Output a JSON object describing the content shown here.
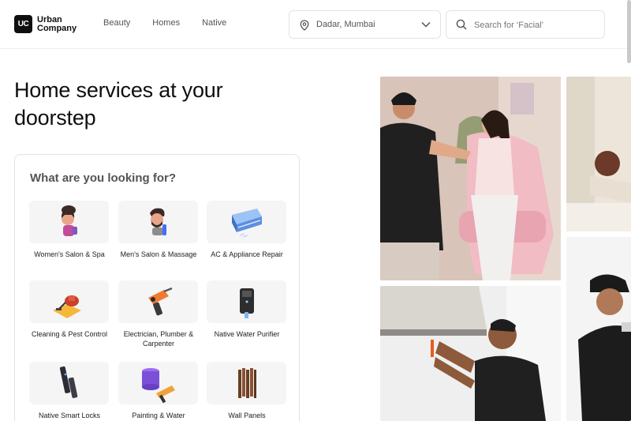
{
  "header": {
    "logo_mark": "UC",
    "logo_line1": "Urban",
    "logo_line2": "Company",
    "nav": [
      "Beauty",
      "Homes",
      "Native"
    ],
    "location": "Dadar, Mumbai",
    "search_placeholder": "Search for ‘Facial’"
  },
  "hero": {
    "title": "Home services at your doorstep"
  },
  "services": {
    "title": "What are you looking for?",
    "items": [
      {
        "label": "Women's Salon & Spa",
        "icon": "woman-salon-icon"
      },
      {
        "label": "Men's Salon & Massage",
        "icon": "man-salon-icon"
      },
      {
        "label": "AC & Appliance Repair",
        "icon": "ac-unit-icon"
      },
      {
        "label": "Cleaning & Pest Control",
        "icon": "vacuum-cleaner-icon"
      },
      {
        "label": "Electrician, Plumber & Carpenter",
        "icon": "drill-icon"
      },
      {
        "label": "Native Water Purifier",
        "icon": "water-purifier-icon"
      },
      {
        "label": "Native Smart Locks",
        "icon": "smart-lock-icon"
      },
      {
        "label": "Painting & Water",
        "icon": "paint-bucket-icon"
      },
      {
        "label": "Wall Panels",
        "icon": "wall-panel-icon"
      }
    ]
  },
  "colors": {
    "text": "#0f0f0f",
    "muted": "#545454",
    "border": "#e3e3e3",
    "tile_bg": "#f5f5f5"
  }
}
